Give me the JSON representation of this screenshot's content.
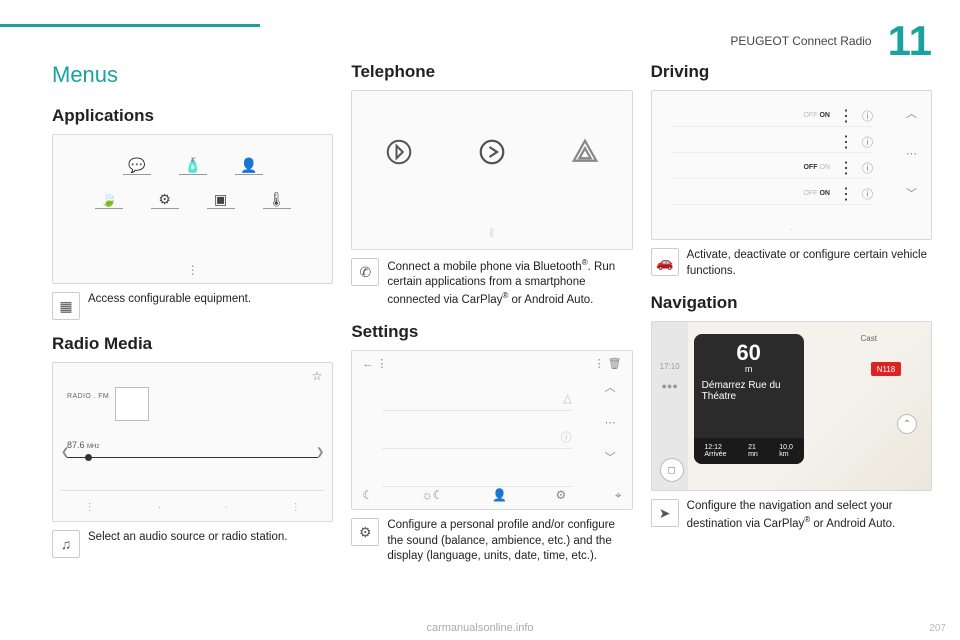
{
  "header": {
    "title": "PEUGEOT Connect Radio",
    "chapter": "11"
  },
  "menus_heading": "Menus",
  "watermark": "carmanualsonline.info",
  "page_number": "207",
  "applications": {
    "title": "Applications",
    "desc": "Access configurable equipment."
  },
  "radio_media": {
    "title": "Radio Media",
    "source_label": "RADIO . FM",
    "freq_value": "87.6",
    "freq_unit": "MHz",
    "desc": "Select an audio source or radio station."
  },
  "telephone": {
    "title": "Telephone",
    "desc_line1": "Connect a mobile phone via Bluetooth",
    "desc_line2": "Run certain applications from a smartphone connected via CarPlay",
    "desc_line3": " or Android Auto."
  },
  "settings": {
    "title": "Settings",
    "desc": "Configure a personal profile and/or configure the sound (balance, ambience, etc.) and the display (language, units, date, time, etc.)."
  },
  "driving": {
    "title": "Driving",
    "off": "OFF",
    "on": "ON",
    "desc": "Activate, deactivate or configure certain vehicle functions."
  },
  "navigation": {
    "title": "Navigation",
    "clock": "17:10",
    "distance_value": "60",
    "distance_unit": "m",
    "street": "Démarrez Rue du Théatre",
    "arrival_time": "12:12",
    "arrival_label": "Arrivée",
    "eta_min": "21",
    "eta_unit": "mn",
    "dist_km": "10,0",
    "dist_unit": "km",
    "road_badge": "N118",
    "poi": "Cast",
    "desc": "Configure the navigation and select your destination via CarPlay",
    "desc_tail": " or Android Auto."
  }
}
